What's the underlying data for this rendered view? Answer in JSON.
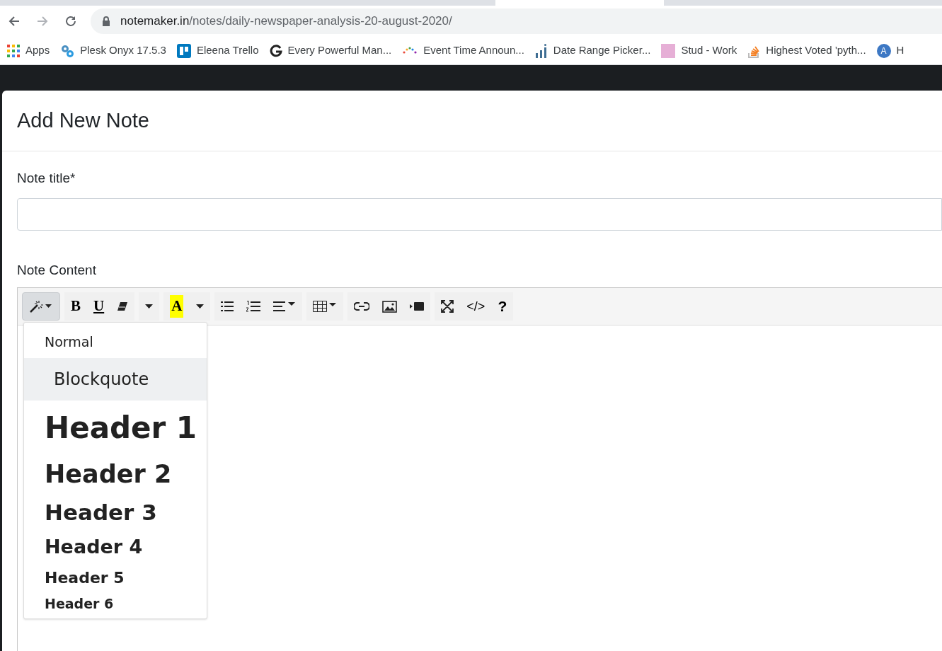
{
  "browser": {
    "url_host": "notemaker.in",
    "url_path": "/notes/daily-newspaper-analysis-20-august-2020/",
    "bookmarks": [
      {
        "kind": "apps",
        "label": "Apps"
      },
      {
        "kind": "gears",
        "label": "Plesk Onyx 17.5.3"
      },
      {
        "kind": "board",
        "label": "Eleena Trello"
      },
      {
        "kind": "g",
        "label": "Every Powerful Man..."
      },
      {
        "kind": "dots",
        "label": "Event Time Announ..."
      },
      {
        "kind": "bars",
        "label": "Date Range Picker..."
      },
      {
        "kind": "square",
        "label": "Stud - Work"
      },
      {
        "kind": "stack",
        "label": "Highest Voted 'pyth..."
      },
      {
        "kind": "circle",
        "label": "H",
        "badge": "A"
      }
    ]
  },
  "modal": {
    "title": "Add New Note",
    "title_label": "Note title*",
    "content_label": "Note Content",
    "toolbar": [
      [
        {
          "kind": "style",
          "selected": true
        }
      ],
      [
        {
          "kind": "bold",
          "label": "B"
        },
        {
          "kind": "underline",
          "label": "U"
        },
        {
          "kind": "eraser",
          "selected": false
        }
      ],
      [
        {
          "kind": "caret",
          "selected": false
        }
      ],
      [
        {
          "kind": "highlight",
          "label": "A"
        },
        {
          "kind": "caret",
          "selected": false
        }
      ],
      [
        {
          "kind": "ul",
          "selected": false
        },
        {
          "kind": "ol",
          "selected": false
        },
        {
          "kind": "align",
          "selected": false
        }
      ],
      [
        {
          "kind": "table",
          "selected": false
        }
      ],
      [
        {
          "kind": "link",
          "selected": false
        },
        {
          "kind": "image",
          "selected": false
        },
        {
          "kind": "video",
          "selected": false
        }
      ],
      [
        {
          "kind": "fullscreen",
          "selected": false
        },
        {
          "kind": "code",
          "label": "</>"
        },
        {
          "kind": "help",
          "label": "?"
        }
      ]
    ],
    "style_menu": [
      {
        "kind": "p",
        "label": "Normal",
        "selected": false
      },
      {
        "kind": "blockquote",
        "label": "Blockquote",
        "selected": true
      },
      {
        "kind": "h1",
        "label": "Header 1",
        "selected": false
      },
      {
        "kind": "h2",
        "label": "Header 2",
        "selected": false
      },
      {
        "kind": "h3",
        "label": "Header 3",
        "selected": false
      },
      {
        "kind": "h4",
        "label": "Header 4",
        "selected": false
      },
      {
        "kind": "h5",
        "label": "Header 5",
        "selected": false
      },
      {
        "kind": "h6",
        "label": "Header 6",
        "selected": false
      }
    ]
  }
}
